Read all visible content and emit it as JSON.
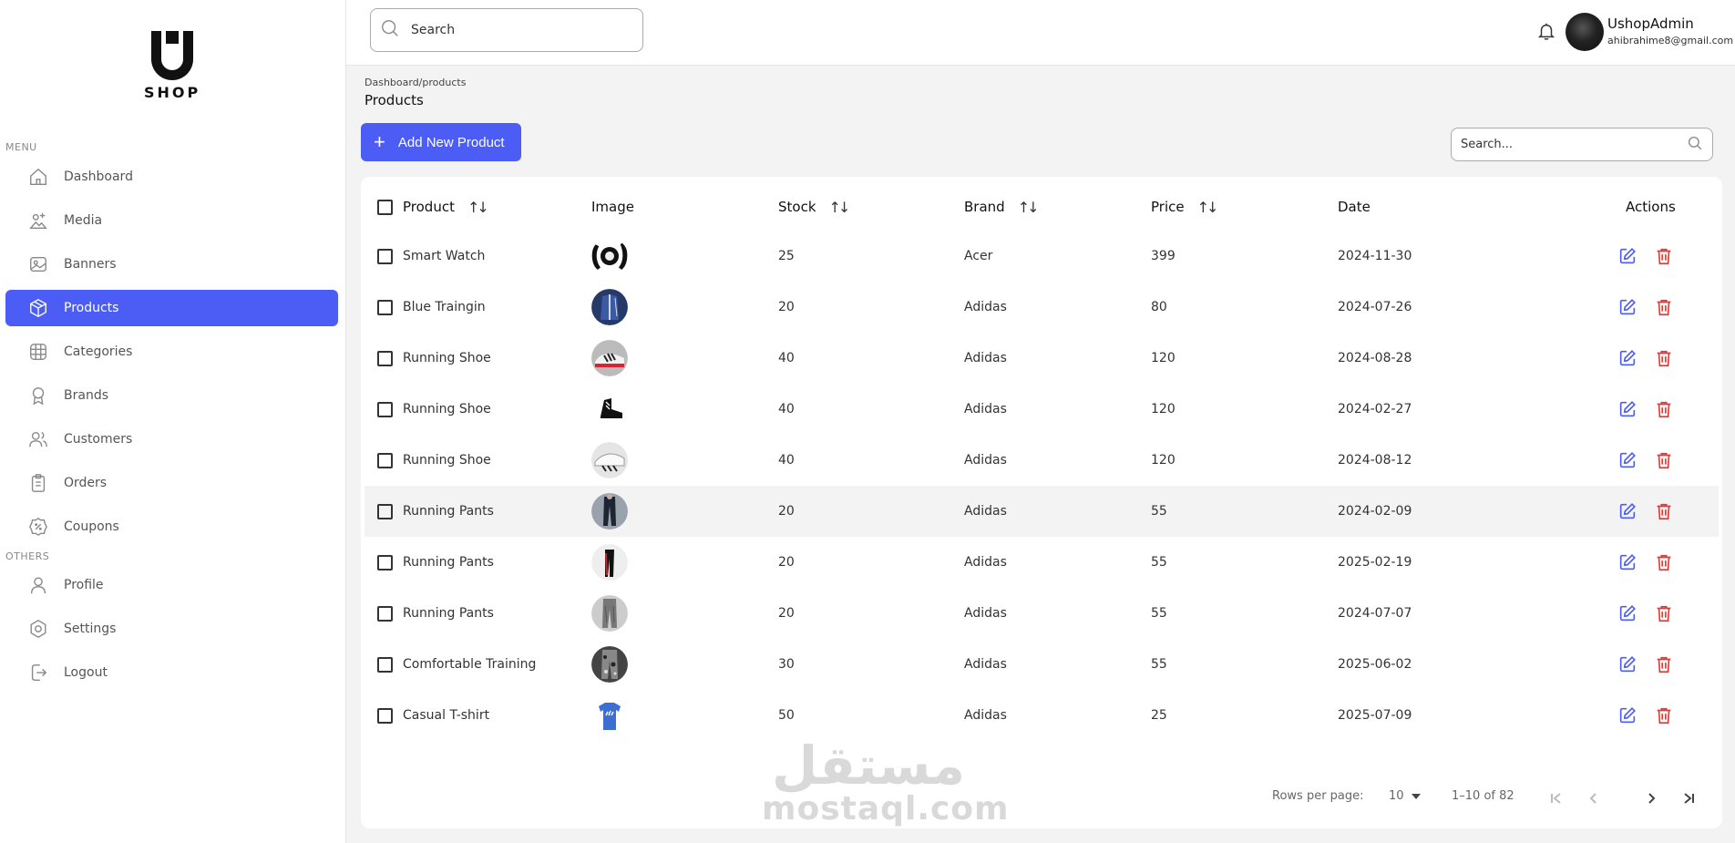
{
  "brand": {
    "logo_letter": "U",
    "logo_text": "SHOP"
  },
  "sidebar": {
    "menu_label": "MENU",
    "others_label": "OTHERS",
    "items": [
      {
        "label": "Dashboard",
        "icon": "home-icon"
      },
      {
        "label": "Media",
        "icon": "image-upload-icon"
      },
      {
        "label": "Banners",
        "icon": "picture-icon"
      },
      {
        "label": "Products",
        "icon": "box-icon",
        "active": true
      },
      {
        "label": "Categories",
        "icon": "grid-icon"
      },
      {
        "label": "Brands",
        "icon": "badge-icon"
      },
      {
        "label": "Customers",
        "icon": "users-icon"
      },
      {
        "label": "Orders",
        "icon": "clipboard-icon"
      },
      {
        "label": "Coupons",
        "icon": "discount-icon"
      }
    ],
    "others": [
      {
        "label": "Profile",
        "icon": "user-icon"
      },
      {
        "label": "Settings",
        "icon": "settings-icon"
      },
      {
        "label": "Logout",
        "icon": "logout-icon"
      }
    ]
  },
  "topbar": {
    "search_placeholder": "Search",
    "user_name": "UshopAdmin",
    "user_email": "ahibrahime8@gmail.com"
  },
  "page": {
    "breadcrumb": "Dashboard/products",
    "title": "Products",
    "add_button": "Add New Product",
    "table_search_placeholder": "Search..."
  },
  "table": {
    "columns": [
      "Product",
      "Image",
      "Stock",
      "Brand",
      "Price",
      "Date",
      "Actions"
    ],
    "rows": [
      {
        "product": "Smart Watch",
        "image": "watch",
        "stock": "25",
        "brand": "Acer",
        "price": "399",
        "date": "2024-11-30"
      },
      {
        "product": "Blue Traingin",
        "image": "blue-jacket",
        "stock": "20",
        "brand": "Adidas",
        "price": "80",
        "date": "2024-07-26"
      },
      {
        "product": "Running Shoe",
        "image": "white-shoe",
        "stock": "40",
        "brand": "Adidas",
        "price": "120",
        "date": "2024-08-28"
      },
      {
        "product": "Running Shoe",
        "image": "black-shoe",
        "stock": "40",
        "brand": "Adidas",
        "price": "120",
        "date": "2024-02-27"
      },
      {
        "product": "Running Shoe",
        "image": "grey-shoe",
        "stock": "40",
        "brand": "Adidas",
        "price": "120",
        "date": "2024-08-12"
      },
      {
        "product": "Running Pants",
        "image": "dark-pants",
        "stock": "20",
        "brand": "Adidas",
        "price": "55",
        "date": "2024-02-09"
      },
      {
        "product": "Running Pants",
        "image": "red-pants",
        "stock": "20",
        "brand": "Adidas",
        "price": "55",
        "date": "2025-02-19"
      },
      {
        "product": "Running Pants",
        "image": "grey-pants",
        "stock": "20",
        "brand": "Adidas",
        "price": "55",
        "date": "2024-07-07"
      },
      {
        "product": "Comfortable Training",
        "image": "camo-pants",
        "stock": "30",
        "brand": "Adidas",
        "price": "55",
        "date": "2025-06-02"
      },
      {
        "product": "Casual T-shirt",
        "image": "blue-tshirt",
        "stock": "50",
        "brand": "Adidas",
        "price": "25",
        "date": "2025-07-09"
      }
    ]
  },
  "pagination": {
    "rows_per_page_label": "Rows per page:",
    "rows_per_page_value": "10",
    "range": "1–10 of 82"
  },
  "watermark": {
    "arabic": "مستقل",
    "latin": "mostaql.com"
  },
  "colors": {
    "accent": "#4b5df4",
    "delete": "#e53935",
    "sidebar_bg": "#ffffff",
    "page_bg": "#f3f3f3"
  }
}
